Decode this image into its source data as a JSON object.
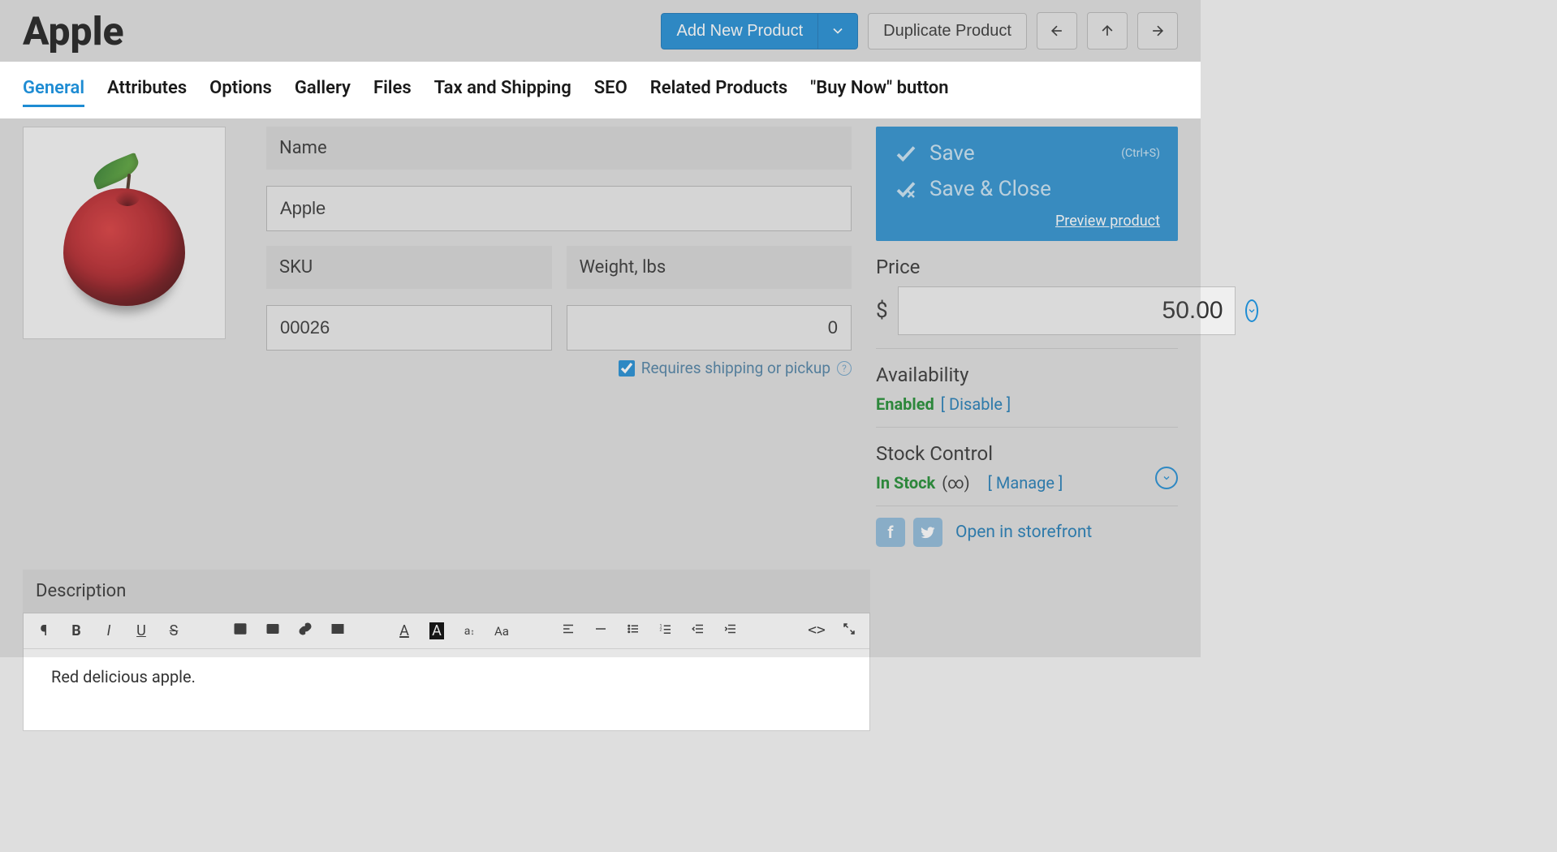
{
  "page": {
    "title": "Apple"
  },
  "header": {
    "add_new": "Add New Product",
    "duplicate": "Duplicate Product"
  },
  "tabs": {
    "general": "General",
    "attributes": "Attributes",
    "options": "Options",
    "gallery": "Gallery",
    "files": "Files",
    "tax_shipping": "Tax and Shipping",
    "seo": "SEO",
    "related": "Related Products",
    "buy_now": "\"Buy Now\" button"
  },
  "fields": {
    "name_label": "Name",
    "name_value": "Apple",
    "sku_label": "SKU",
    "sku_value": "00026",
    "weight_label": "Weight, lbs",
    "weight_value": "0",
    "requires_shipping": "Requires shipping or pickup"
  },
  "description": {
    "label": "Description",
    "body": "Red delicious apple."
  },
  "sidebar": {
    "save": "Save",
    "save_hint": "(Ctrl+S)",
    "save_close": "Save & Close",
    "preview": "Preview product",
    "price_label": "Price",
    "currency": "$",
    "price_value": "50.00",
    "availability_label": "Availability",
    "availability_status": "Enabled",
    "disable_link": "[ Disable ]",
    "stock_label": "Stock Control",
    "stock_status": "In Stock",
    "stock_qty": "(∞)",
    "manage_link": "[ Manage ]",
    "storefront": "Open in storefront"
  }
}
